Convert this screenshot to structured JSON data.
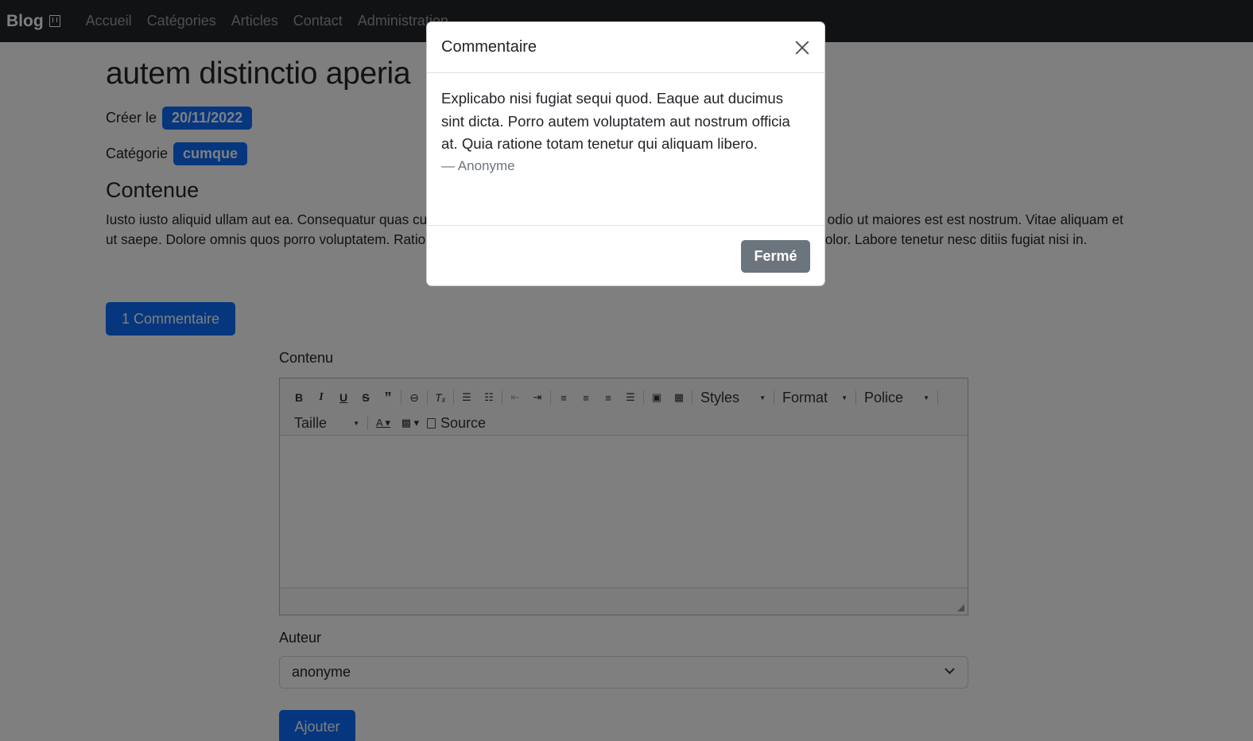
{
  "navbar": {
    "brand": "Blog",
    "links": [
      "Accueil",
      "Catégories",
      "Articles",
      "Contact",
      "Administration"
    ]
  },
  "post": {
    "title": "autem distinctio aperia",
    "created_label": "Créer le",
    "created_date": "20/11/2022",
    "category_label": "Catégorie",
    "category": "cumque",
    "content_heading": "Contenue",
    "body": "Iusto iusto aliquid ullam aut ea. Consequatur quas cumque. Possimus fugiat temporibus quam magni. Laudantium quis odio ut maiores est est nostrum. Vitae aliquam et ut saepe. Dolore omnis quos porro voluptatem. Ratione ntur fugit hic. Eaque perspiciatis aut omnis optio consequatur dolor. Labore tenetur nesc ditiis fugiat nisi in.",
    "comments_button": "1 Commentaire"
  },
  "form": {
    "content_label": "Contenu",
    "toolbar": {
      "styles": "Styles",
      "format": "Format",
      "font": "Police",
      "size": "Taille",
      "source": "Source"
    },
    "author_label": "Auteur",
    "author_selected": "anonyme",
    "submit_label": "Ajouter"
  },
  "modal": {
    "title": "Commentaire",
    "comment_text": "Explicabo nisi fugiat sequi quod. Eaque aut ducimus sint dicta. Porro autem voluptatem aut nostrum officia at. Quia ratione totam tenetur qui aliquam libero.",
    "comment_author": "— Anonyme",
    "close_button": "Fermé"
  }
}
